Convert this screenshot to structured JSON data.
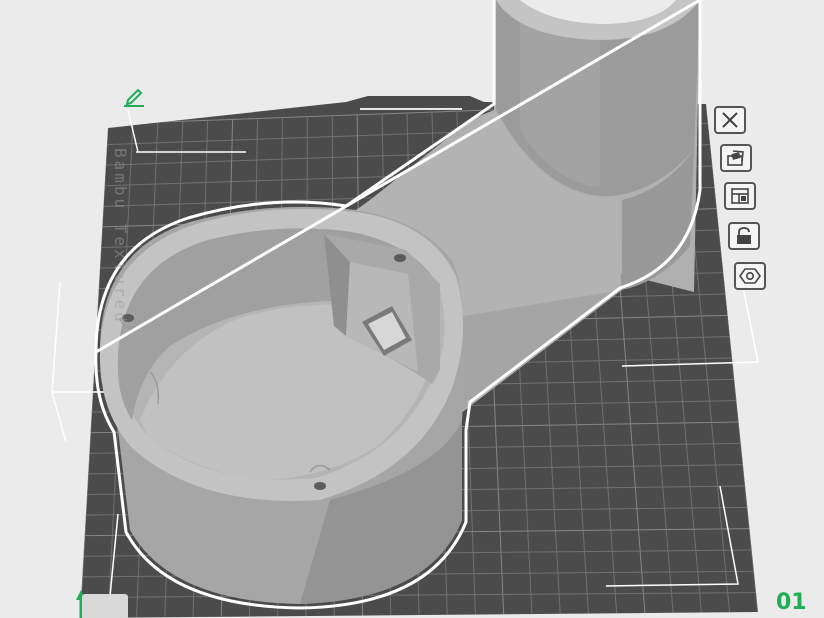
{
  "viewport": {
    "plate_label": "Bambu Textured",
    "plate_index": "01"
  },
  "toolbar": {
    "buttons": [
      {
        "name": "close-button",
        "icon": "close-icon"
      },
      {
        "name": "auto-orient-button",
        "icon": "auto-orient-icon"
      },
      {
        "name": "arrange-button",
        "icon": "arrange-icon"
      },
      {
        "name": "lock-button",
        "icon": "lock-icon"
      },
      {
        "name": "plate-settings-button",
        "icon": "settings-gear-icon"
      }
    ]
  },
  "icons": {
    "edit": "edit-pencil-icon"
  },
  "colors": {
    "background": "#ebebeb",
    "plate": "#4a4a4a",
    "grid": "#8a8a8a",
    "model_light": "#bdbdbd",
    "model_mid": "#a3a3a3",
    "model_dark": "#8e8e8e",
    "accent_green": "#1fae55"
  }
}
